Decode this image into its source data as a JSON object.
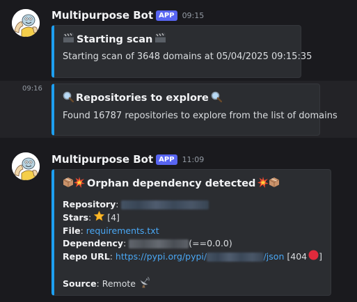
{
  "messages": [
    {
      "username": "Multipurpose Bot",
      "badge": "APP",
      "time": "09:15",
      "embed": {
        "title": "Starting scan",
        "description": "Starting scan of 3648 domains at 05/04/2025 09:15:35"
      }
    },
    {
      "side_time": "09:16",
      "embed": {
        "title": "Repositories to explore",
        "description": "Found 16787 repositories to explore from the list of domains"
      }
    },
    {
      "username": "Multipurpose Bot",
      "badge": "APP",
      "time": "11:09",
      "embed": {
        "title": "Orphan dependency detected",
        "fields": {
          "repository_label": "Repository",
          "stars_label": "Stars",
          "stars_value": "[4]",
          "file_label": "File",
          "file_value": "requirements.txt",
          "dependency_label": "Dependency",
          "dependency_version": "(==0.0.0)",
          "repo_url_label": "Repo URL",
          "repo_url_prefix": "https://pypi.org/pypi/",
          "repo_url_suffix": "/json",
          "repo_url_status_open": "[404",
          "repo_url_status_close": "]",
          "source_label": "Source",
          "source_value": "Remote"
        }
      }
    }
  ],
  "colors": {
    "background": "#1a1a1e",
    "embed_accent": "#1e9ff0",
    "app_badge": "#5865f2",
    "link": "#4aa8f5"
  },
  "icons": [
    "clapper-board-icon",
    "magnifying-glass-icon",
    "package-icon",
    "collision-icon",
    "star-icon",
    "red-circle-icon",
    "satellite-antenna-icon"
  ]
}
